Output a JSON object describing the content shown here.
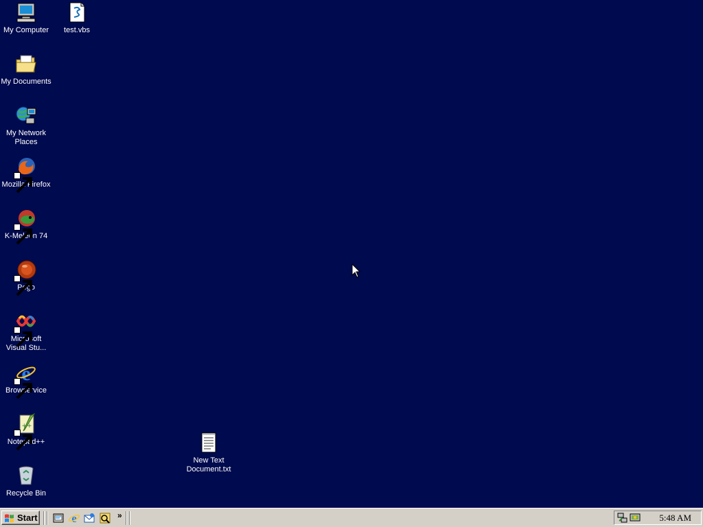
{
  "desktop": {
    "background_color": "#000a4e",
    "icons": [
      {
        "label": "My Computer",
        "icon": "my-computer-icon"
      },
      {
        "label": "test.vbs",
        "icon": "vbs-script-icon"
      },
      {
        "label": "My Documents",
        "icon": "my-documents-folder-icon"
      },
      {
        "label": "My Network Places",
        "icon": "network-places-icon"
      },
      {
        "label": "Mozilla Firefox",
        "icon": "firefox-icon"
      },
      {
        "label": "K-Meleon 74",
        "icon": "k-meleon-icon"
      },
      {
        "label": "Pego",
        "icon": "pego-icon"
      },
      {
        "label": "Microsoft Visual Stu...",
        "icon": "visual-studio-icon"
      },
      {
        "label": "Browservice",
        "icon": "internet-explorer-icon"
      },
      {
        "label": "Notepad++",
        "icon": "notepad-plus-plus-icon"
      },
      {
        "label": "Recycle Bin",
        "icon": "recycle-bin-icon"
      },
      {
        "label": "New Text Document.txt",
        "icon": "text-document-icon"
      }
    ]
  },
  "taskbar": {
    "start_label": "Start",
    "quick_launch": [
      "show-desktop-icon",
      "internet-explorer-icon",
      "outlook-express-icon",
      "media-icon"
    ],
    "overflow_label": "»",
    "tray_icons": [
      "network-tray-icon",
      "monitor-tray-icon"
    ],
    "clock": "5:48 AM"
  }
}
